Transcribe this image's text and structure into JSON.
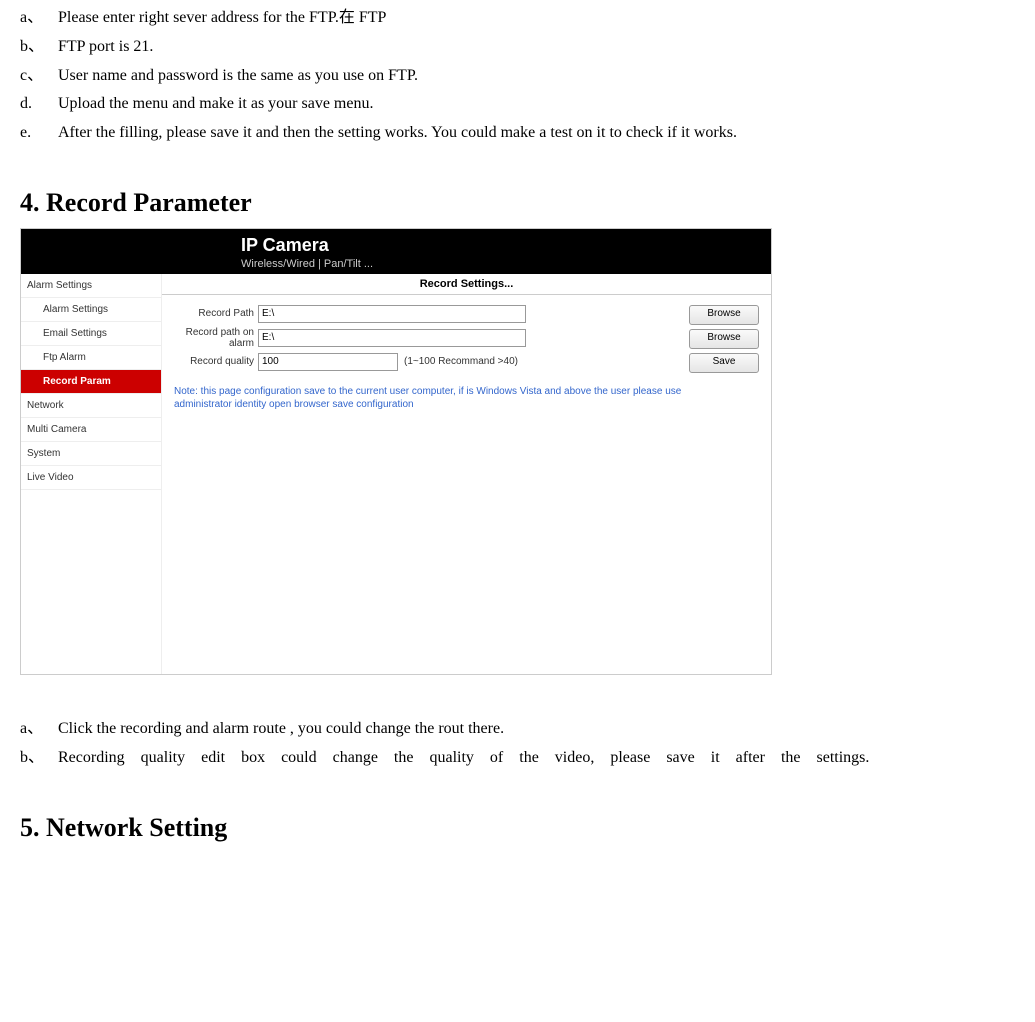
{
  "intro_list": [
    {
      "marker": "a、",
      "text": "Please enter right sever address for the FTP.在 FTP"
    },
    {
      "marker": "b、",
      "text": "FTP port is 21."
    },
    {
      "marker": "c、",
      "text": "User name and password is the same as you use on FTP."
    },
    {
      "marker": "d.",
      "text": "Upload the menu and make it as your save menu."
    },
    {
      "marker": "e.",
      "text": "After the filling, please save it and then the setting works. You could make a test on it to check if it works."
    }
  ],
  "section4_heading": "4. Record Parameter",
  "screenshot": {
    "header_title": "IP Camera",
    "header_sub": "Wireless/Wired  |  Pan/Tilt  ...",
    "sidebar": {
      "groups": [
        {
          "label": "Alarm Settings",
          "items": [
            {
              "label": "Alarm Settings",
              "active": false
            },
            {
              "label": "Email Settings",
              "active": false
            },
            {
              "label": "Ftp Alarm",
              "active": false
            },
            {
              "label": "Record Param",
              "active": true
            }
          ]
        },
        {
          "label": "Network",
          "items": []
        },
        {
          "label": "Multi Camera",
          "items": []
        },
        {
          "label": "System",
          "items": []
        },
        {
          "label": "Live Video",
          "items": []
        }
      ]
    },
    "panel_title": "Record Settings...",
    "form": {
      "record_path_label": "Record Path",
      "record_path_value": "E:\\",
      "record_path_alarm_label": "Record path on alarm",
      "record_path_alarm_value": "E:\\",
      "record_quality_label": "Record quality",
      "record_quality_value": "100",
      "record_quality_hint": "(1~100 Recommand >40)",
      "browse_label": "Browse",
      "save_label": "Save",
      "note": "Note: this page configuration save to the current user computer, if is Windows Vista and above the user please use administrator identity open browser save configuration"
    }
  },
  "after_list": [
    {
      "marker": "a、",
      "text": "Click the recording and alarm route , you could change the rout there."
    },
    {
      "marker": "b、",
      "text": "Recording quality edit box could change the quality of the video, please save it after the settings.",
      "justify": true
    }
  ],
  "section5_heading": "5. Network Setting"
}
